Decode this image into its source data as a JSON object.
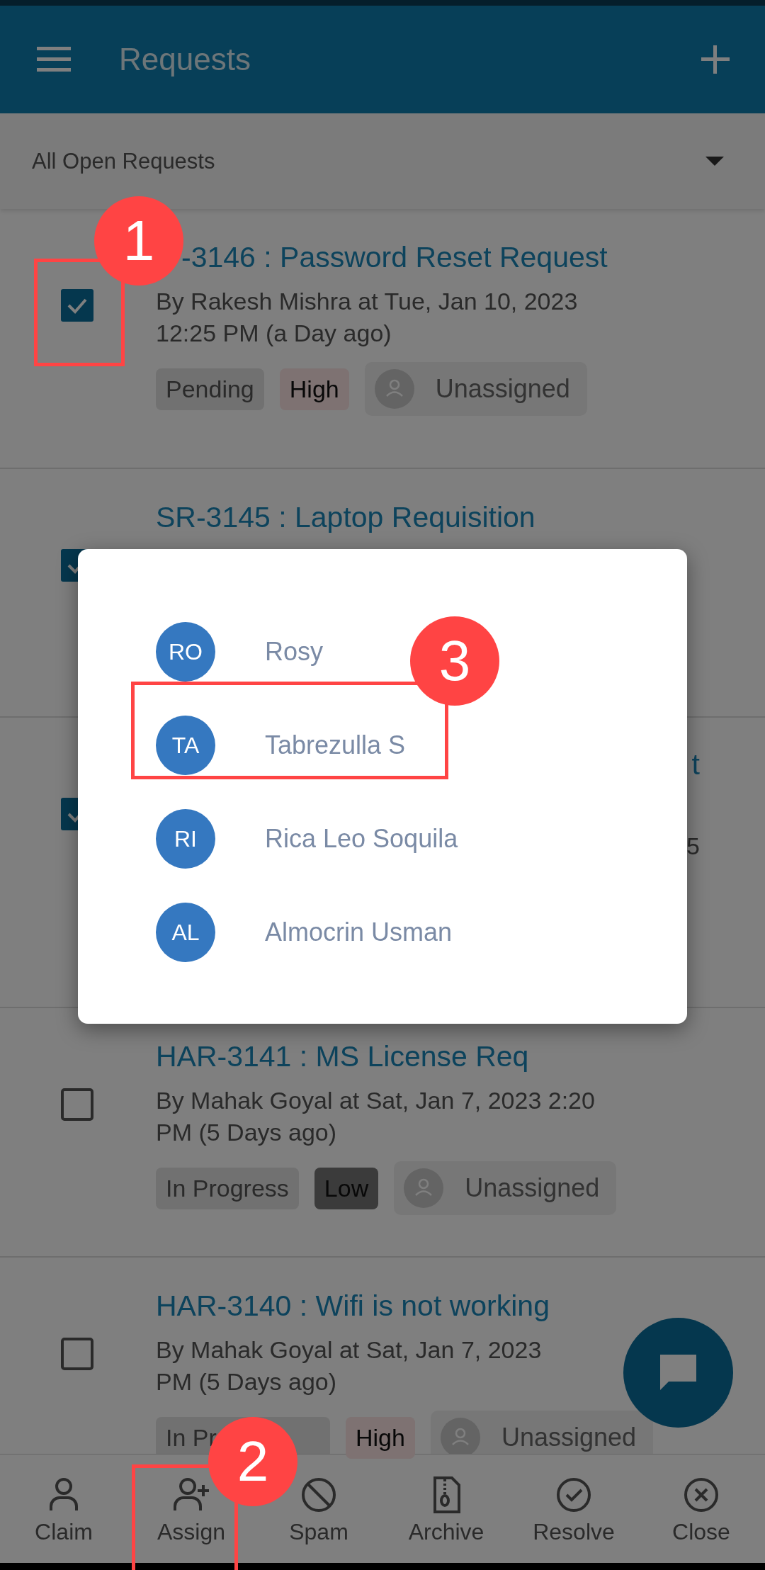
{
  "header": {
    "title": "Requests"
  },
  "filter": {
    "label": "All Open Requests"
  },
  "rows": [
    {
      "kind": "request",
      "checked": true,
      "title": "-3146 : Password Reset Request",
      "meta": [
        "By Rakesh Mishra at Tue, Jan 10, 2023",
        "12:25 PM (a Day ago)"
      ],
      "tags": [
        {
          "kind": "status",
          "label": "Pending"
        },
        {
          "kind": "priority",
          "label": "High",
          "color": "#7e7272"
        },
        {
          "kind": "assignee",
          "label": "Unassigned"
        }
      ]
    },
    {
      "kind": "request",
      "checked": true,
      "title": "SR-3145 : Laptop Requisition"
    },
    {
      "kind": "covered",
      "checked": true,
      "title": "t",
      "meta": [
        "5"
      ]
    },
    {
      "kind": "request",
      "checked": false,
      "title": "HAR-3141 : MS License Req",
      "meta": [
        "By Mahak Goyal at Sat, Jan 7, 2023 2:20",
        "PM (5 Days ago)"
      ],
      "tags": [
        {
          "kind": "status",
          "label": "In Progress"
        },
        {
          "kind": "priority",
          "label": "Low",
          "color": "#3b3b3b"
        },
        {
          "kind": "assignee",
          "label": "Unassigned"
        }
      ]
    },
    {
      "kind": "request",
      "checked": false,
      "title": "HAR-3140 : Wifi is not working",
      "meta": [
        "By Mahak Goyal at Sat, Jan 7, 2023",
        "PM (5 Days ago)"
      ],
      "tags": [
        {
          "kind": "status",
          "label": "In Pr"
        },
        {
          "kind": "priority",
          "label": "High",
          "color": "#7e7272"
        },
        {
          "kind": "assignee",
          "label": "Unassigned"
        }
      ]
    }
  ],
  "bottom_nav": [
    {
      "kind": "claim",
      "label": "Claim"
    },
    {
      "kind": "assign",
      "label": "Assign"
    },
    {
      "kind": "spam",
      "label": "Spam"
    },
    {
      "kind": "archive",
      "label": "Archive"
    },
    {
      "kind": "resolve",
      "label": "Resolve"
    },
    {
      "kind": "close",
      "label": "Close"
    }
  ],
  "assign_dialog": {
    "agents": [
      {
        "initials": "RO",
        "name": "Rosy"
      },
      {
        "initials": "TA",
        "name": "Tabrezulla S"
      },
      {
        "initials": "RI",
        "name": "Rica Leo Soquila"
      },
      {
        "initials": "AL",
        "name": "Almocrin Usman"
      }
    ]
  },
  "annotations": [
    {
      "number": "1"
    },
    {
      "number": "2"
    },
    {
      "number": "3"
    }
  ]
}
